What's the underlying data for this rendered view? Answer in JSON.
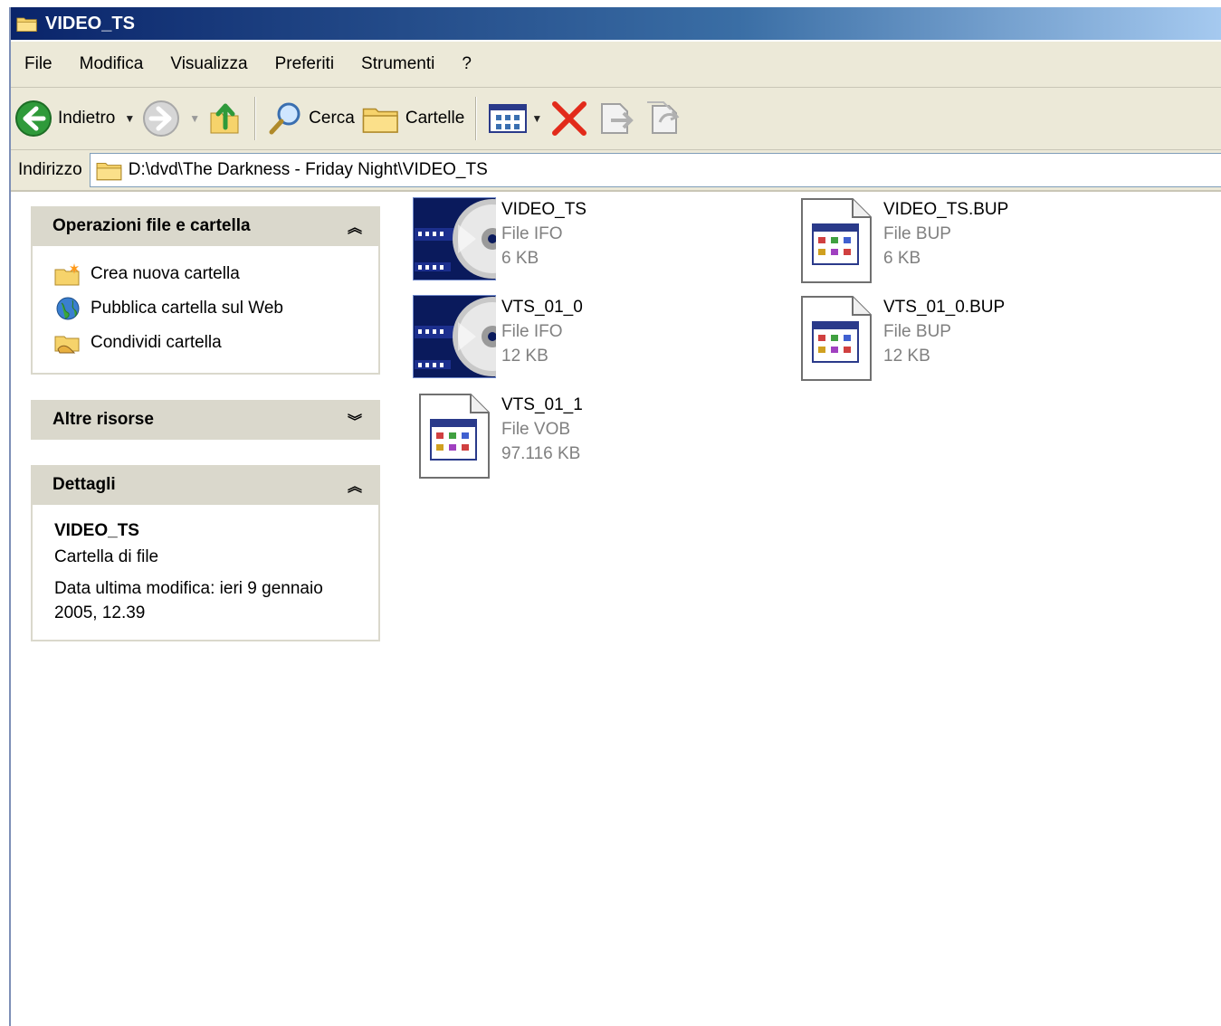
{
  "window": {
    "title": "VIDEO_TS"
  },
  "menu": [
    "File",
    "Modifica",
    "Visualizza",
    "Preferiti",
    "Strumenti",
    "?"
  ],
  "toolbar": {
    "back_label": "Indietro",
    "search_label": "Cerca",
    "folders_label": "Cartelle"
  },
  "address": {
    "label": "Indirizzo",
    "path": "D:\\dvd\\The Darkness - Friday Night\\VIDEO_TS"
  },
  "panels": {
    "file_ops": {
      "title": "Operazioni file e cartella",
      "items": [
        "Crea nuova cartella",
        "Pubblica cartella sul Web",
        "Condividi cartella"
      ]
    },
    "other": {
      "title": "Altre risorse"
    },
    "details": {
      "title": "Dettagli",
      "name": "VIDEO_TS",
      "type": "Cartella di file",
      "modified": "Data ultima modifica: ieri 9 gennaio 2005, 12.39"
    }
  },
  "files": [
    {
      "name": "VIDEO_TS",
      "type": "File IFO",
      "size": "6 KB",
      "icon": "dvd-ifo-icon"
    },
    {
      "name": "VIDEO_TS.BUP",
      "type": "File BUP",
      "size": "6 KB",
      "icon": "generic-file-icon"
    },
    {
      "name": "VTS_01_0",
      "type": "File IFO",
      "size": "12 KB",
      "icon": "dvd-ifo-icon"
    },
    {
      "name": "VTS_01_0.BUP",
      "type": "File BUP",
      "size": "12 KB",
      "icon": "generic-file-icon"
    },
    {
      "name": "VTS_01_1",
      "type": "File VOB",
      "size": "97.116 KB",
      "icon": "generic-file-icon"
    }
  ]
}
